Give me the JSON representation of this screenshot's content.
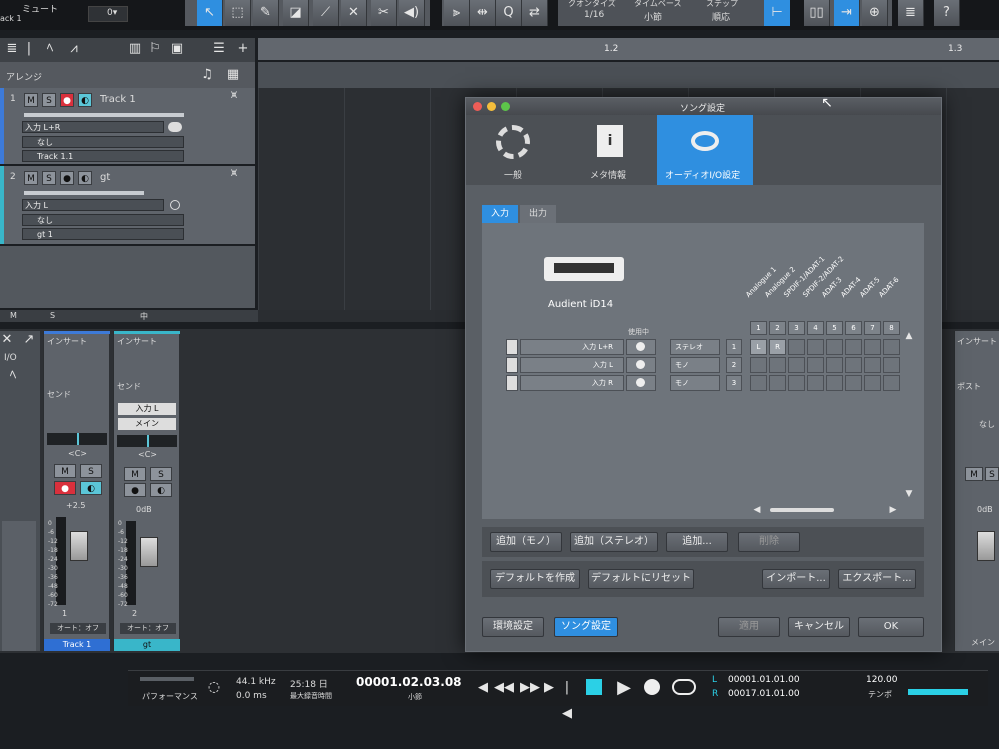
{
  "top": {
    "mute_label": "ミュート",
    "track_label": "ack 1",
    "quantize_label": "クオンタイズ",
    "quantize_value": "1/16",
    "timebase_label": "タイムベース",
    "timebase_value": "小節",
    "step_label": "ステップ",
    "step_value": "順応",
    "help": "?"
  },
  "ruler": {
    "m12": "1.2",
    "m13": "1.3"
  },
  "arrange": {
    "title": "アレンジ"
  },
  "tracks": [
    {
      "num": "1",
      "m": "M",
      "s": "S",
      "name": "Track 1",
      "input": "入力 L+R",
      "none": "なし",
      "inst": "Track 1.1"
    },
    {
      "num": "2",
      "m": "M",
      "s": "S",
      "name": "gt",
      "input": "入力 L",
      "none": "なし",
      "inst": "gt 1"
    }
  ],
  "trackfooter": {
    "m": "M",
    "s": "S",
    "mid": "中"
  },
  "mixer": {
    "io": "I/O",
    "ch1": {
      "insert": "インサート",
      "send": "センド",
      "pan": "<C>",
      "m": "M",
      "s": "S",
      "gain": "+2.5",
      "num": "1",
      "auto": "オート：オフ",
      "name": "Track 1"
    },
    "ch2": {
      "insert": "インサート",
      "send": "センド",
      "input": "入力 L",
      "main": "メイン",
      "pan": "<C>",
      "m": "M",
      "s": "S",
      "gain": "0dB",
      "num": "2",
      "auto": "オート：オフ",
      "name": "gt"
    },
    "right": {
      "insert": "インサート",
      "post": "ポスト",
      "none": "なし",
      "m": "M",
      "s": "S",
      "gain": "0dB",
      "main": "メイン"
    }
  },
  "scale": [
    "0",
    "-6",
    "-12",
    "-18",
    "-24",
    "-30",
    "-36",
    "-48",
    "-60",
    "-72"
  ],
  "dialog": {
    "title": "ソング設定",
    "tabs": [
      "一般",
      "メタ情報",
      "オーディオI/O設定"
    ],
    "subtabs": [
      "入力",
      "出力"
    ],
    "device": "Audient iD14",
    "in_use": "使用中",
    "cols": [
      "Analogue 1",
      "Analogue 2",
      "SPDIF-1/ADAT-1",
      "SPDIF-2/ADAT-2",
      "ADAT-3",
      "ADAT-4",
      "ADAT-5",
      "ADAT-6"
    ],
    "colnums": [
      "1",
      "2",
      "3",
      "4",
      "5",
      "6",
      "7",
      "8"
    ],
    "rows": [
      {
        "name": "入力 L+R",
        "type": "ステレオ",
        "num": "1"
      },
      {
        "name": "入力 L",
        "type": "モノ",
        "num": "2"
      },
      {
        "name": "入力 R",
        "type": "モノ",
        "num": "3"
      }
    ],
    "cell_l": "L",
    "cell_r": "R",
    "btn_add_mono": "追加（モノ）",
    "btn_add_stereo": "追加（ステレオ）",
    "btn_add": "追加...",
    "btn_delete": "削除",
    "btn_make_default": "デフォルトを作成",
    "btn_reset_default": "デフォルトにリセット",
    "btn_import": "インポート...",
    "btn_export": "エクスポート...",
    "btn_env": "環境設定",
    "btn_song": "ソング設定",
    "btn_apply": "適用",
    "btn_cancel": "キャンセル",
    "btn_ok": "OK"
  },
  "transport": {
    "perf": "パフォーマンス",
    "rate": "44.1 kHz",
    "latency": "0.0 ms",
    "rec_time": "25:18 日",
    "rec_label": "最大録音時間",
    "position": "00001.02.03.08",
    "pos_unit": "小節",
    "loop_l": "00001.01.01.00",
    "loop_r": "00017.01.01.00",
    "tempo": "120.00",
    "tempo_label": "テンポ",
    "l": "L",
    "r": "R"
  }
}
